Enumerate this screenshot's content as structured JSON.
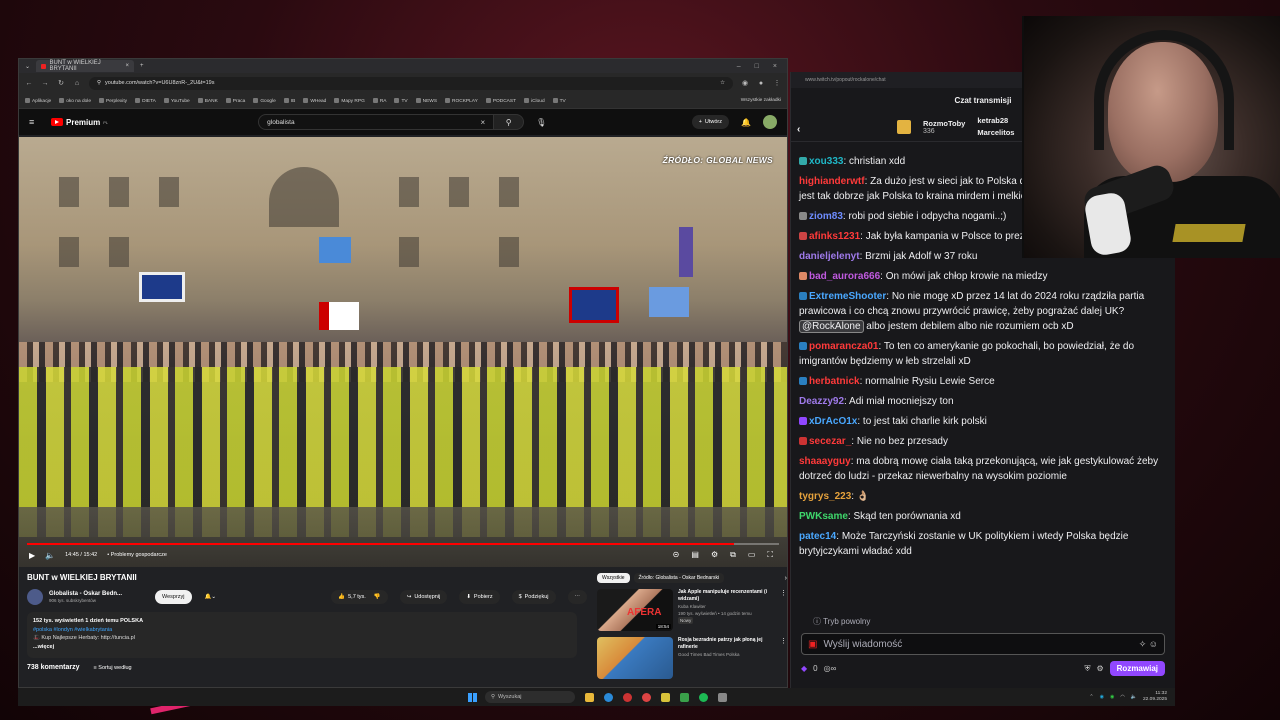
{
  "browser": {
    "tab_title": "BUNT w WIELKIEJ BRYTANII",
    "url": "youtube.com/watch?v=U6U8znR-_2U&t=19s",
    "bookmarks": [
      "Aplikacje",
      "oko na dole",
      "Perplexity",
      "DIETA",
      "YouTube",
      "BANK",
      "Praca",
      "Google",
      "IB",
      "WHead",
      "Mapy RPG",
      "RA",
      "TV",
      "NEWS",
      "ROCKPLAY",
      "PODCAST",
      "iCloud",
      "TV"
    ],
    "bookmarks_right": "Wszystkie zakładki"
  },
  "youtube": {
    "logo_text": "Premium",
    "logo_sup": "PL",
    "search_value": "globalista",
    "create_label": "Utwórz",
    "video": {
      "source_label": "ŹRÓDŁO: GLOBAL NEWS",
      "time": "14:45 / 15:42",
      "chapter": "• Problemy gospodarcze",
      "progress": 0.94
    },
    "title": "BUNT w WIELKIEJ BRYTANII",
    "channel_name": "Globalista - Oskar Bedn...",
    "channel_subs": "906 tys. subskrybentów",
    "support_label": "Wesprzyj",
    "likes": "5,7 tys.",
    "share_label": "Udostępnij",
    "download_label": "Pobierz",
    "thanks_label": "Podziękuj",
    "desc_stats": "152 tys. wyświetleń  1 dzień temu  POLSKA",
    "desc_tags": "#polska #londyn #wielkabrytania",
    "desc_line": "🎩 Kup Najlepsze Herbaty: http://tuncia.pl",
    "desc_more": "...więcej",
    "comments_count": "738 komentarzy",
    "sort_label": "Sortuj według",
    "chips": [
      "Wszystkie",
      "Źródło: Globalista - Oskar Bednarski"
    ],
    "related": [
      {
        "title": "Jak Apple manipuluje recenzentami (i widzami)",
        "channel": "Kuba Klawiter",
        "meta": "190 tys. wyświetleń • 14 godzin temu",
        "badge": "Nowy",
        "duration": "18:54",
        "thumb_text": "AFERA"
      },
      {
        "title": "Rosja bezradnie patrzy jak płoną jej rafinerie",
        "channel": "Good Times Bad Times Polska",
        "meta": "",
        "badge": "",
        "duration": "",
        "thumb_text": ""
      }
    ]
  },
  "chat": {
    "url": "www.twitch.tv/popout/rockalone/chat",
    "title": "Czat transmisji",
    "gifters": [
      {
        "name": "RozmoToby",
        "count": "336"
      },
      {
        "name": "ketrab28",
        "count": ""
      },
      {
        "name": "Marcelitos",
        "count": ""
      }
    ],
    "messages": [
      {
        "user": "xou333",
        "color": "#1fb8c8",
        "badge": "#3aa",
        "text": "christian xdd"
      },
      {
        "user": "highianderwtf",
        "color": "#ff3a3a",
        "badge": "",
        "text": "Za dużo jest w sieci jak to Polska dane są przeszacowane. Nie jest tak dobrze jak Polska to kraina mirdem i melkiem płynąca"
      },
      {
        "user": "ziom83",
        "color": "#6e8cff",
        "badge": "#888",
        "text": "robi pod siebie i odpycha nogami..;)"
      },
      {
        "user": "afinks1231",
        "color": "#ff3a3a",
        "badge": "#c44",
        "text": "Jak była kampania w Polsce to prezydenta Rumuni"
      },
      {
        "user": "danieljelenyt",
        "color": "#9f7aea",
        "badge": "",
        "text": "Brzmi jak Adolf w 37 roku"
      },
      {
        "user": "bad_aurora666",
        "color": "#c05ae0",
        "badge": "#d86",
        "text": "On mówi jak chłop krowie na miedzy"
      },
      {
        "user": "ExtremeShooter",
        "color": "#4aa8ff",
        "badge": "#2a7fc0",
        "text": "No nie mogę xD przez 14 lat do 2024 roku rządziła partia prawicowa i co chcą znowu przywrócić prawicę, żeby pograżać dalej UK?",
        "mention": "@RockAlone",
        "tail": "albo jestem debilem albo nie rozumiem ocb xD"
      },
      {
        "user": "pomarancza01",
        "color": "#ff3a3a",
        "badge": "#2a7fc0",
        "text": "To ten co amerykanie go pokochali, bo powiedział, że do imigrantów będziemy w łeb strzelali xD"
      },
      {
        "user": "herbatnick",
        "color": "#ff3a3a",
        "badge": "#2a7fc0",
        "text": "normalnie Rysiu Lewie Serce"
      },
      {
        "user": "Deazzy92",
        "color": "#9f7aea",
        "badge": "",
        "text": "Adi miał mocniejszy ton"
      },
      {
        "user": "xDrAcO1x",
        "color": "#4aa8ff",
        "badge": "#9147ff",
        "text": "to jest taki charlie kirk polski"
      },
      {
        "user": "secezar_",
        "color": "#ff3a3a",
        "badge": "#c33",
        "text": "Nie no bez przesady"
      },
      {
        "user": "shaaayguy",
        "color": "#ff3a3a",
        "badge": "",
        "text": "ma dobrą mowę ciała taką przekonującą, wie jak gestykulować żeby dotrzeć do ludzi - przekaz niewerbalny na wysokim poziomie"
      },
      {
        "user": "tygrys_223",
        "color": "#e6a23c",
        "badge": "",
        "text": "👌🏼"
      },
      {
        "user": "PWKsame",
        "color": "#3ed66b",
        "badge": "",
        "text": "Skąd ten porównania xd"
      },
      {
        "user": "patec14",
        "color": "#4aa8ff",
        "badge": "",
        "text": "Może Tarczyński zostanie w UK politykiem i wtedy Polska będzie brytyjczykami władać xdd"
      }
    ],
    "slow_mode": "Tryb powolny",
    "input_placeholder": "Wyślij wiadomość",
    "points": "0",
    "send_label": "Rozmawiaj"
  },
  "taskbar": {
    "search_placeholder": "Wyszukaj",
    "time": "11:32",
    "date": "22.09.2025"
  }
}
